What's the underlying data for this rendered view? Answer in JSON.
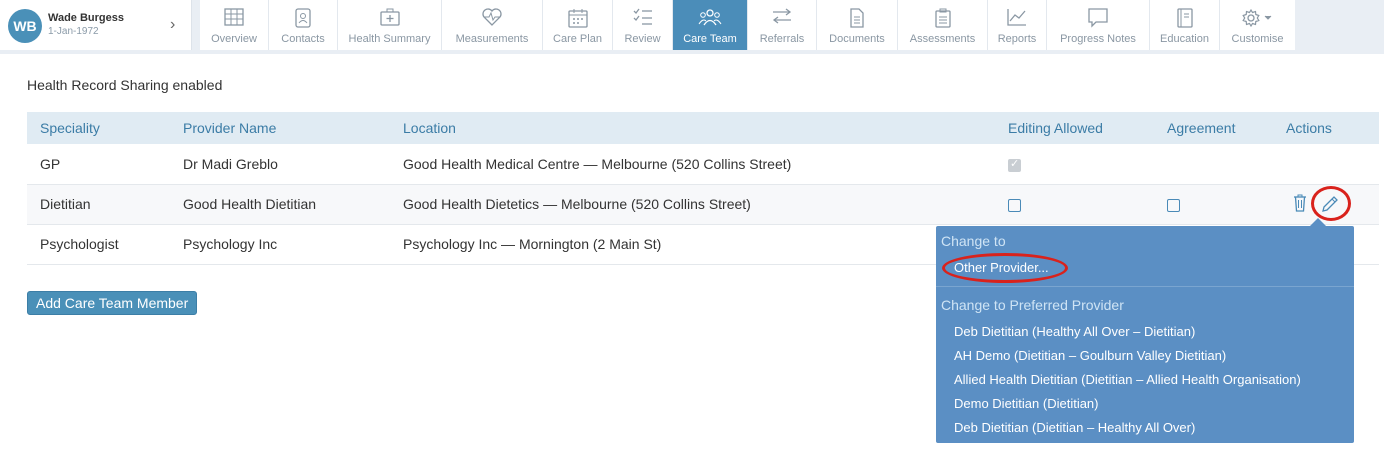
{
  "patient": {
    "initials": "WB",
    "name": "Wade Burgess",
    "dob": "1-Jan-1972"
  },
  "nav": {
    "tabs": [
      {
        "label": "Overview",
        "icon": "table-icon"
      },
      {
        "label": "Contacts",
        "icon": "contacts-icon"
      },
      {
        "label": "Health Summary",
        "icon": "medical-kit-icon"
      },
      {
        "label": "Measurements",
        "icon": "heart-pulse-icon"
      },
      {
        "label": "Care Plan",
        "icon": "calendar-icon"
      },
      {
        "label": "Review",
        "icon": "checklist-icon"
      },
      {
        "label": "Care Team",
        "icon": "team-icon"
      },
      {
        "label": "Referrals",
        "icon": "arrows-icon"
      },
      {
        "label": "Documents",
        "icon": "document-icon"
      },
      {
        "label": "Assessments",
        "icon": "clipboard-icon"
      },
      {
        "label": "Reports",
        "icon": "chart-icon"
      },
      {
        "label": "Progress Notes",
        "icon": "speech-bubble-icon"
      },
      {
        "label": "Education",
        "icon": "book-icon"
      },
      {
        "label": "Customise",
        "icon": "gear-icon"
      }
    ],
    "active_tab": "Care Team"
  },
  "sharing_status": "Health Record Sharing enabled",
  "table": {
    "headers": {
      "speciality": "Speciality",
      "provider": "Provider Name",
      "location": "Location",
      "editing": "Editing Allowed",
      "agreement": "Agreement",
      "actions": "Actions"
    },
    "rows": [
      {
        "speciality": "GP",
        "provider": "Dr Madi Greblo",
        "location": "Good Health Medical Centre — Melbourne (520 Collins Street)",
        "editing_allowed": true,
        "editing_disabled": true,
        "agreement": null
      },
      {
        "speciality": "Dietitian",
        "provider": "Good Health Dietitian",
        "location": "Good Health Dietetics — Melbourne (520 Collins Street)",
        "editing_allowed": false,
        "agreement": false
      },
      {
        "speciality": "Psychologist",
        "provider": "Psychology Inc",
        "location": "Psychology Inc — Mornington (2 Main St)",
        "editing_allowed": null,
        "agreement": null
      }
    ]
  },
  "add_button_label": "Add Care Team Member",
  "dropdown": {
    "change_to_header": "Change to",
    "other_provider": "Other Provider...",
    "preferred_header": "Change to Preferred Provider",
    "preferred_items": [
      "Deb Dietitian (Healthy All Over – Dietitian)",
      "AH Demo (Dietitian – Goulburn Valley Dietitian)",
      "Allied Health Dietitian (Dietitian – Allied Health Organisation)",
      "Demo Dietitian (Dietitian)",
      "Deb Dietitian (Dietitian – Healthy All Over)"
    ]
  },
  "colors": {
    "accent": "#4b8db9",
    "dropdown_bg": "#5b8fc4",
    "highlight": "#d9221c"
  }
}
